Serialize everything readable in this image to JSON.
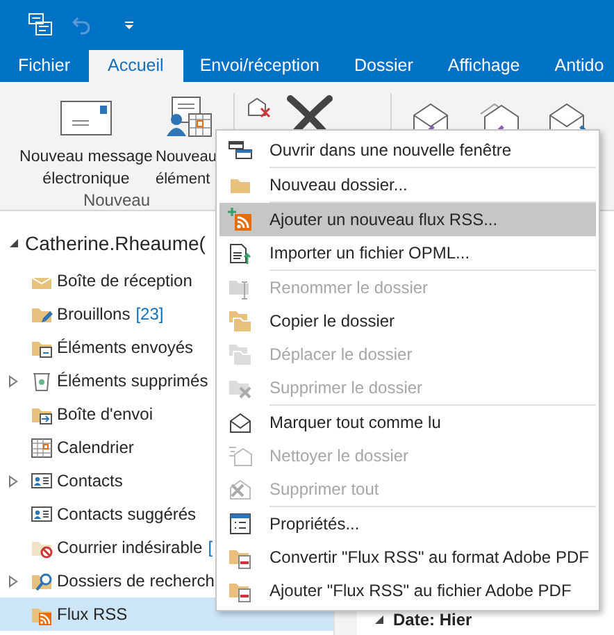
{
  "tabs": [
    {
      "label": "Fichier",
      "selected": false
    },
    {
      "label": "Accueil",
      "selected": true
    },
    {
      "label": "Envoi/réception",
      "selected": false
    },
    {
      "label": "Dossier",
      "selected": false
    },
    {
      "label": "Affichage",
      "selected": false
    },
    {
      "label": "Antido",
      "selected": false
    }
  ],
  "ribbon": {
    "group_label": "Nouveau",
    "buttons": [
      {
        "lines": [
          "Nouveau message",
          "électronique"
        ]
      },
      {
        "lines": [
          "Nouveau",
          "élément"
        ]
      }
    ]
  },
  "folder_pane": {
    "account": {
      "label": "Catherine.Rheaume(",
      "expanded": true
    },
    "folders": [
      {
        "name": "Boîte de réception",
        "has_children": false,
        "selected": false
      },
      {
        "name": "Brouillons",
        "count": "[23]",
        "has_children": false,
        "selected": false
      },
      {
        "name": "Éléments envoyés",
        "has_children": false,
        "selected": false
      },
      {
        "name": "Éléments supprimés",
        "has_children": true,
        "selected": false
      },
      {
        "name": "Boîte d'envoi",
        "has_children": false,
        "selected": false
      },
      {
        "name": "Calendrier",
        "has_children": false,
        "selected": false
      },
      {
        "name": "Contacts",
        "has_children": true,
        "selected": false
      },
      {
        "name": "Contacts suggérés",
        "has_children": false,
        "selected": false
      },
      {
        "name": "Courrier indésirable",
        "count": "[",
        "has_children": false,
        "selected": false
      },
      {
        "name": "Dossiers de recherch",
        "has_children": true,
        "selected": false
      },
      {
        "name": "Flux RSS",
        "has_children": false,
        "selected": true
      }
    ]
  },
  "message_list": {
    "group_header": "Date: Hier"
  },
  "context_menu": [
    {
      "kind": "item",
      "label": "Ouvrir dans une nouvelle fenêtre",
      "disabled": false,
      "selected": false
    },
    {
      "kind": "separator"
    },
    {
      "kind": "item",
      "label": "Nouveau dossier...",
      "disabled": false,
      "selected": false
    },
    {
      "kind": "separator"
    },
    {
      "kind": "item",
      "label": "Ajouter un nouveau flux RSS...",
      "disabled": false,
      "selected": true
    },
    {
      "kind": "item",
      "label": "Importer un fichier OPML...",
      "disabled": false,
      "selected": false
    },
    {
      "kind": "separator"
    },
    {
      "kind": "item",
      "label": "Renommer le dossier",
      "disabled": true,
      "selected": false
    },
    {
      "kind": "item",
      "label": "Copier le dossier",
      "disabled": false,
      "selected": false
    },
    {
      "kind": "item",
      "label": "Déplacer le dossier",
      "disabled": true,
      "selected": false
    },
    {
      "kind": "item",
      "label": "Supprimer le dossier",
      "disabled": true,
      "selected": false
    },
    {
      "kind": "separator"
    },
    {
      "kind": "item",
      "label": "Marquer tout comme lu",
      "disabled": false,
      "selected": false
    },
    {
      "kind": "item",
      "label": "Nettoyer le dossier",
      "disabled": true,
      "selected": false
    },
    {
      "kind": "item",
      "label": "Supprimer tout",
      "disabled": true,
      "selected": false
    },
    {
      "kind": "separator"
    },
    {
      "kind": "item",
      "label": "Propriétés...",
      "disabled": false,
      "selected": false
    },
    {
      "kind": "item",
      "label": "Convertir \"Flux RSS\" au format Adobe PDF",
      "disabled": false,
      "selected": false
    },
    {
      "kind": "item",
      "label": "Ajouter \"Flux RSS\" au fichier Adobe PDF",
      "disabled": false,
      "selected": false
    }
  ]
}
